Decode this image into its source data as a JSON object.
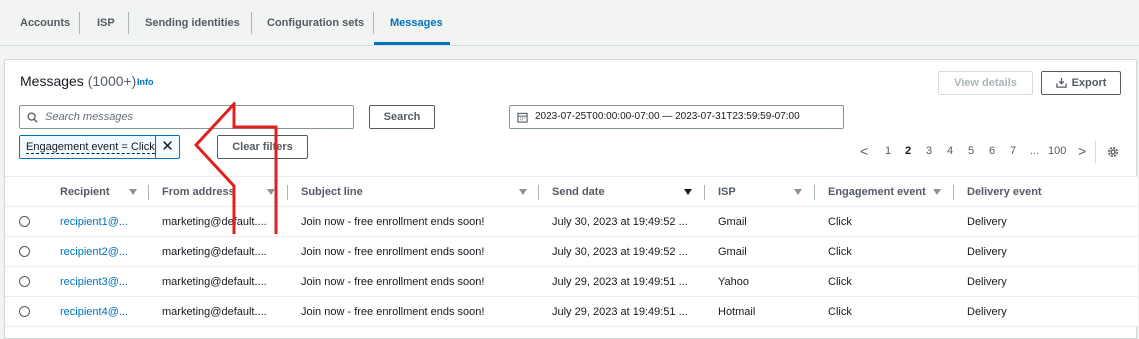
{
  "tabs": [
    {
      "label": "Accounts"
    },
    {
      "label": "ISP"
    },
    {
      "label": "Sending identities"
    },
    {
      "label": "Configuration sets"
    },
    {
      "label": "Messages",
      "active": true
    }
  ],
  "panel": {
    "title": "Messages",
    "count": "(1000+)",
    "info": "Info",
    "view_details": "View details",
    "export": "Export"
  },
  "search": {
    "placeholder": "Search messages",
    "button": "Search"
  },
  "daterange": {
    "value": "2023-07-25T00:00:00-07:00 — 2023-07-31T23:59:59-07:00"
  },
  "filter": {
    "token": "Engagement event = Click",
    "clear": "Clear filters"
  },
  "pagination": {
    "prev": "<",
    "pages": [
      "1",
      "2",
      "3",
      "4",
      "5",
      "6",
      "7",
      "...",
      "100"
    ],
    "current": "2",
    "next": ">"
  },
  "columns": [
    "Recipient",
    "From address",
    "Subject line",
    "Send date",
    "ISP",
    "Engagement event",
    "Delivery event"
  ],
  "rows": [
    {
      "recipient": "recipient1@...",
      "from": "marketing@default....",
      "subject": "Join now - free enrollment ends soon!",
      "date": "July 30, 2023 at 19:49:52 ...",
      "isp": "Gmail",
      "engagement": "Click",
      "delivery": "Delivery"
    },
    {
      "recipient": "recipient2@...",
      "from": "marketing@default....",
      "subject": "Join now - free enrollment ends soon!",
      "date": "July 30, 2023 at 19:49:52 ...",
      "isp": "Gmail",
      "engagement": "Click",
      "delivery": "Delivery"
    },
    {
      "recipient": "recipient3@...",
      "from": "marketing@default....",
      "subject": "Join now - free enrollment ends soon!",
      "date": "July 29, 2023 at 19:49:51 ...",
      "isp": "Yahoo",
      "engagement": "Click",
      "delivery": "Delivery"
    },
    {
      "recipient": "recipient4@...",
      "from": "marketing@default....",
      "subject": "Join now - free enrollment ends soon!",
      "date": "July 29, 2023 at 19:49:51 ...",
      "isp": "Hotmail",
      "engagement": "Click",
      "delivery": "Delivery"
    }
  ],
  "colors": {
    "accent": "#0073bb",
    "annotation_arrow": "#e0201f"
  }
}
